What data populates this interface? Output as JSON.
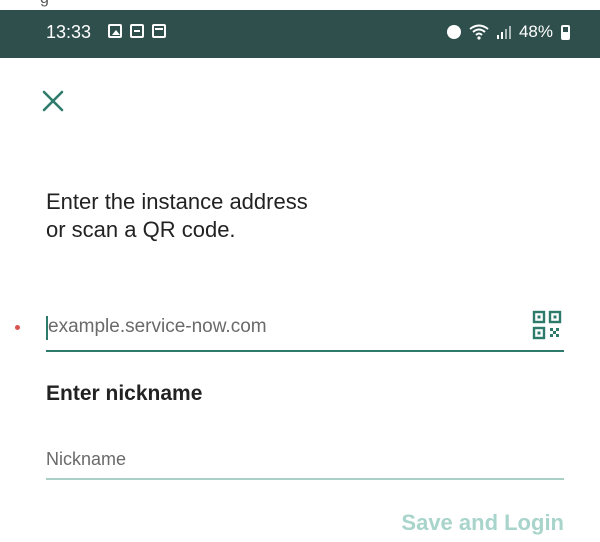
{
  "top_strip": {
    "clipped_text": "g"
  },
  "status_bar": {
    "time": "13:33",
    "battery": "48%",
    "left_icons": [
      "photo-icon",
      "message-icon",
      "calendar-icon"
    ],
    "right_icons": [
      "alarm-icon",
      "wifi-icon",
      "signal-icon",
      "battery-icon"
    ],
    "background": "#2f4f4c"
  },
  "header": {
    "close_icon": "close-icon"
  },
  "instructions": {
    "line1": "Enter the instance address",
    "line2": "or scan a QR code."
  },
  "instance_field": {
    "value": "",
    "placeholder": "example.service-now.com",
    "required": true,
    "qr_icon": "qr-code-icon"
  },
  "nickname_section": {
    "label": "Enter nickname",
    "value": "",
    "placeholder": "Nickname"
  },
  "actions": {
    "save_label": "Save and Login"
  },
  "colors": {
    "accent": "#2e7b6b",
    "accent_light": "#a9cfc7",
    "disabled_button": "#a8d4cb",
    "required_marker": "#d9534f"
  }
}
